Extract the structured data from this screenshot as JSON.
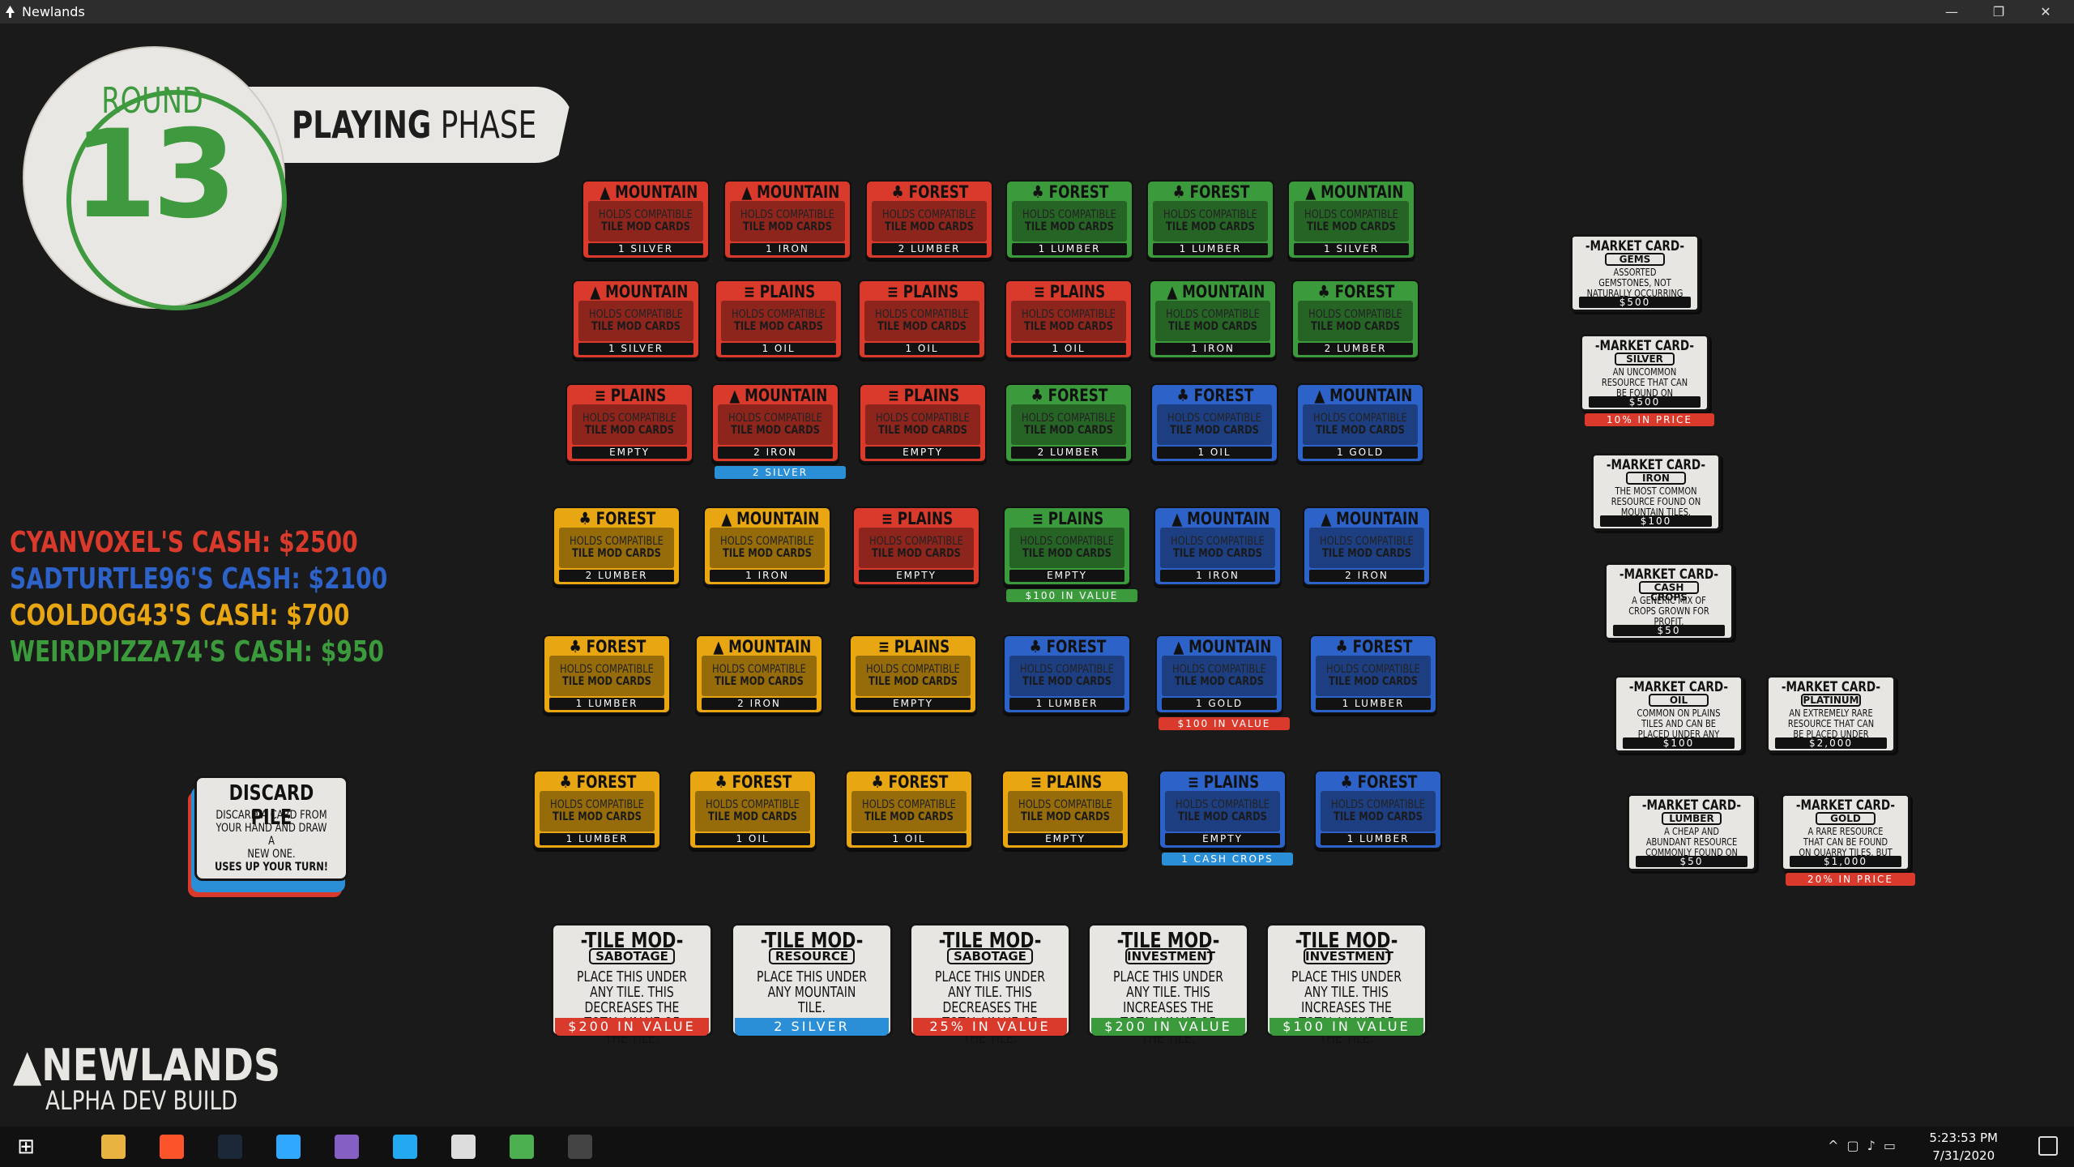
{
  "window": {
    "title": "Newlands",
    "min": "—",
    "max": "❐",
    "close": "✕"
  },
  "round": {
    "label": "ROUND",
    "number": "13"
  },
  "phase": {
    "bold": "PLAYING",
    "thin": " PHASE"
  },
  "players": [
    {
      "text": "CYANVOXEL'S CASH: $2500",
      "color": "#d93a2b"
    },
    {
      "text": "SADTURTLE96'S CASH: $2100",
      "color": "#2d62c8"
    },
    {
      "text": "COOLDOG43'S CASH: $700",
      "color": "#e7a612"
    },
    {
      "text": "WEIRDPIZZA74'S CASH: $950",
      "color": "#3b9a3b"
    }
  ],
  "card_text": {
    "line1": "HOLDS COMPATIBLE",
    "line2": "TILE MOD CARDS"
  },
  "tiles": [
    {
      "type": "MOUNTAIN",
      "color": "#d93a2b",
      "footer": "1 SILVER"
    },
    {
      "type": "MOUNTAIN",
      "color": "#d93a2b",
      "footer": "1 IRON"
    },
    {
      "type": "FOREST",
      "color": "#d93a2b",
      "footer": "2 LUMBER"
    },
    {
      "type": "FOREST",
      "color": "#3b9a3b",
      "footer": "1 LUMBER"
    },
    {
      "type": "FOREST",
      "color": "#3b9a3b",
      "footer": "1 LUMBER"
    },
    {
      "type": "MOUNTAIN",
      "color": "#3b9a3b",
      "footer": "1 SILVER"
    },
    {
      "type": "MOUNTAIN",
      "color": "#d93a2b",
      "footer": "1 SILVER"
    },
    {
      "type": "PLAINS",
      "color": "#d93a2b",
      "footer": "1 OIL"
    },
    {
      "type": "PLAINS",
      "color": "#d93a2b",
      "footer": "1 OIL"
    },
    {
      "type": "PLAINS",
      "color": "#d93a2b",
      "footer": "1 OIL"
    },
    {
      "type": "MOUNTAIN",
      "color": "#3b9a3b",
      "footer": "1 IRON"
    },
    {
      "type": "FOREST",
      "color": "#3b9a3b",
      "footer": "2 LUMBER"
    },
    {
      "type": "PLAINS",
      "color": "#d93a2b",
      "footer": "EMPTY"
    },
    {
      "type": "MOUNTAIN",
      "color": "#d93a2b",
      "footer": "2 IRON"
    },
    {
      "type": "PLAINS",
      "color": "#d93a2b",
      "footer": "EMPTY"
    },
    {
      "type": "FOREST",
      "color": "#3b9a3b",
      "footer": "2 LUMBER"
    },
    {
      "type": "FOREST",
      "color": "#2d62c8",
      "footer": "1 OIL"
    },
    {
      "type": "MOUNTAIN",
      "color": "#2d62c8",
      "footer": "1 GOLD"
    },
    {
      "type": "FOREST",
      "color": "#e7a612",
      "footer": "2 LUMBER"
    },
    {
      "type": "MOUNTAIN",
      "color": "#e7a612",
      "footer": "1 IRON"
    },
    {
      "type": "PLAINS",
      "color": "#d93a2b",
      "footer": "EMPTY"
    },
    {
      "type": "PLAINS",
      "color": "#3b9a3b",
      "footer": "EMPTY"
    },
    {
      "type": "MOUNTAIN",
      "color": "#2d62c8",
      "footer": "1 IRON"
    },
    {
      "type": "MOUNTAIN",
      "color": "#2d62c8",
      "footer": "2 IRON"
    },
    {
      "type": "FOREST",
      "color": "#e7a612",
      "footer": "1 LUMBER"
    },
    {
      "type": "MOUNTAIN",
      "color": "#e7a612",
      "footer": "2 IRON"
    },
    {
      "type": "PLAINS",
      "color": "#e7a612",
      "footer": "EMPTY"
    },
    {
      "type": "FOREST",
      "color": "#2d62c8",
      "footer": "1 LUMBER"
    },
    {
      "type": "MOUNTAIN",
      "color": "#2d62c8",
      "footer": "1 GOLD"
    },
    {
      "type": "FOREST",
      "color": "#2d62c8",
      "footer": "1 LUMBER"
    },
    {
      "type": "FOREST",
      "color": "#e7a612",
      "footer": "1 LUMBER"
    },
    {
      "type": "FOREST",
      "color": "#e7a612",
      "footer": "1 OIL"
    },
    {
      "type": "FOREST",
      "color": "#e7a612",
      "footer": "1 OIL"
    },
    {
      "type": "PLAINS",
      "color": "#e7a612",
      "footer": "EMPTY"
    },
    {
      "type": "PLAINS",
      "color": "#2d62c8",
      "footer": "EMPTY"
    },
    {
      "type": "FOREST",
      "color": "#2d62c8",
      "footer": "1 LUMBER"
    }
  ],
  "tile_tags": [
    {
      "tile": 13,
      "text": "2 SILVER",
      "color": "#2a8fd6"
    },
    {
      "tile": 21,
      "text": "$100 IN VALUE",
      "color": "#3b9a3b"
    },
    {
      "tile": 28,
      "text": "$100 IN VALUE",
      "color": "#d93a2b"
    },
    {
      "tile": 34,
      "text": "1 CASH CROPS",
      "color": "#2a8fd6"
    }
  ],
  "market_cards": [
    {
      "title": "-MARKET CARD-",
      "sub": "GEMS",
      "desc": "ASSORTED GEMSTONES, NOT NATURALLY OCCURRING ON ANY TILES.",
      "price": "$500"
    },
    {
      "title": "-MARKET CARD-",
      "sub": "SILVER",
      "desc": "AN UNCOMMON RESOURCE THAT CAN BE FOUND ON MOUNTAIN TILES.",
      "price": "$500",
      "tag": "10% IN PRICE",
      "tag_color": "#d93a2b"
    },
    {
      "title": "-MARKET CARD-",
      "sub": "IRON",
      "desc": "THE MOST COMMON RESOURCE FOUND ON MOUNTAIN TILES.",
      "price": "$100"
    },
    {
      "title": "-MARKET CARD-",
      "sub": "CASH CROPS",
      "desc": "A GENERIC MIX OF CROPS GROWN FOR PROFIT.",
      "price": "$50"
    },
    {
      "title": "-MARKET CARD-",
      "sub": "OIL",
      "desc": "COMMON ON PLAINS TILES AND CAN BE PLACED UNDER ANY TILE.",
      "price": "$100"
    },
    {
      "title": "-MARKET CARD-",
      "sub": "PLATINUM",
      "desc": "AN EXTREMELY RARE RESOURCE THAT CAN BE PLACED UNDER MOUNTAIN TILES.",
      "price": "$2,000"
    },
    {
      "title": "-MARKET CARD-",
      "sub": "LUMBER",
      "desc": "A CHEAP AND ABUNDANT RESOURCE COMMONLY FOUND ON FOREST TILES.",
      "price": "$50"
    },
    {
      "title": "-MARKET CARD-",
      "sub": "GOLD",
      "desc": "A RARE RESOURCE THAT CAN BE FOUND ON QUARRY TILES, BUT CAN BE PLACED UNDER ANY TILE.",
      "price": "$1,000",
      "tag": "20% IN PRICE",
      "tag_color": "#d93a2b"
    }
  ],
  "tile_mods": [
    {
      "title": "-TILE MOD-",
      "sub": "SABOTAGE",
      "desc": "PLACE THIS UNDER ANY TILE. THIS DECREASES THE TOTAL VALUE OF THE TILE.",
      "foot": "$200 IN VALUE",
      "foot_color": "#d93a2b"
    },
    {
      "title": "-TILE MOD-",
      "sub": "RESOURCE",
      "desc": "PLACE THIS UNDER ANY MOUNTAIN TILE.",
      "foot": "2 SILVER",
      "foot_color": "#2a8fd6"
    },
    {
      "title": "-TILE MOD-",
      "sub": "SABOTAGE",
      "desc": "PLACE THIS UNDER ANY TILE. THIS DECREASES THE TOTAL VALUE OF THE TILE.",
      "foot": "25% IN VALUE",
      "foot_color": "#d93a2b"
    },
    {
      "title": "-TILE MOD-",
      "sub": "INVESTMENT",
      "desc": "PLACE THIS UNDER ANY TILE. THIS INCREASES THE TOTAL VALUE OF THE TILE.",
      "foot": "$200 IN VALUE",
      "foot_color": "#3b9a3b"
    },
    {
      "title": "-TILE MOD-",
      "sub": "INVESTMENT",
      "desc": "PLACE THIS UNDER ANY TILE. THIS INCREASES THE TOTAL VALUE OF THE TILE.",
      "foot": "$100 IN VALUE",
      "foot_color": "#3b9a3b"
    }
  ],
  "discard": {
    "title": "DISCARD PILE",
    "line1": "DISCARD A CARD FROM",
    "line2": "YOUR HAND AND DRAW A",
    "line3": "NEW ONE.",
    "line4": "USES UP YOUR TURN!"
  },
  "logo": {
    "name": "NEWLANDS",
    "build": "ALPHA DEV BUILD"
  },
  "taskbar": {
    "apps": [
      "windows-start-icon",
      "file-explorer-icon",
      "brave-icon",
      "steam-icon",
      "photoshop-icon",
      "visual-studio-icon",
      "vscode-icon",
      "unity-icon",
      "chrome-icon",
      "newlands-app-icon"
    ],
    "time": "5:23:53 PM",
    "date": "7/31/2020"
  }
}
